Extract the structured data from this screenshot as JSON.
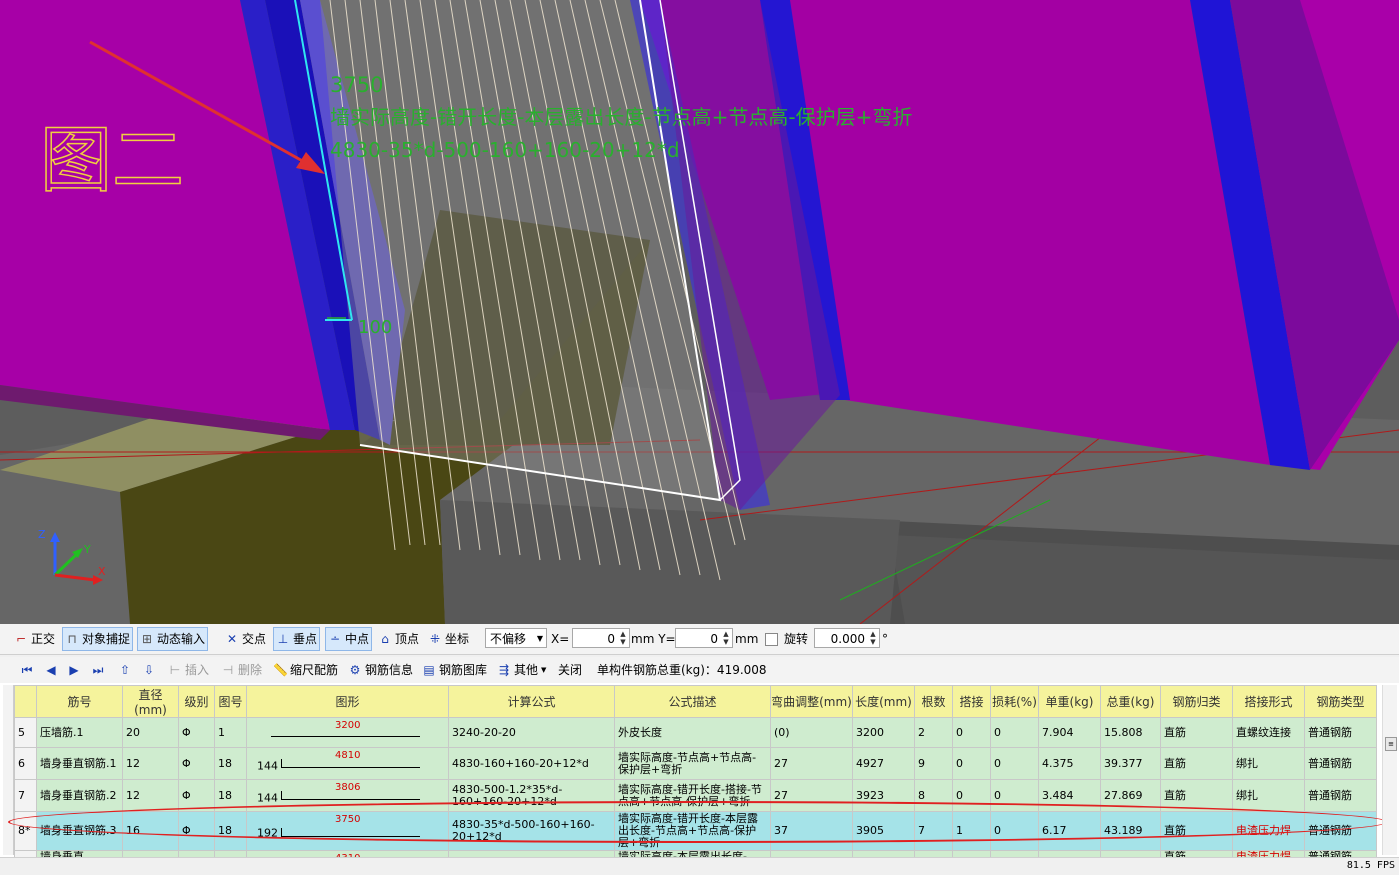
{
  "viewport": {
    "dimension_value": "3750",
    "formula_desc": "墙实际高度-错开长度-本层露出长度-节点高+节点高-保护层+弯折",
    "formula_calc": "4830-35*d-500-160+160-20+12*d",
    "bend_value": "100",
    "annotation_text": "图二",
    "axis_labels": {
      "z": "Z",
      "y": "Y",
      "x": "X"
    },
    "colors": {
      "magenta": "#a800a8",
      "blue": "#1f14d6",
      "floor": "#5d5d5d",
      "label_green": "#29b02e",
      "annotation_red": "#e03030"
    }
  },
  "toolbar1": {
    "ortho": "正交",
    "object_snap": "对象捕捉",
    "dynamic_input": "动态输入",
    "intersection": "交点",
    "perpendicular": "垂点",
    "midpoint": "中点",
    "vertex": "顶点",
    "coordinate": "坐标",
    "offset_select": "不偏移",
    "x_label": "X=",
    "x_value": "0",
    "y_label": "mm Y=",
    "y_value": "0",
    "mm_label": "mm",
    "rotate_label": "旋转",
    "rotate_value": "0.000",
    "degree_symbol": "°"
  },
  "toolbar2": {
    "insert": "插入",
    "delete": "删除",
    "scale_rebar": "缩尺配筋",
    "rebar_info": "钢筋信息",
    "rebar_library": "钢筋图库",
    "other": "其他",
    "close": "关闭",
    "total_weight": "单构件钢筋总重(kg)：419.008"
  },
  "table": {
    "headers": [
      "",
      "筋号",
      "直径(mm)",
      "级别",
      "图号",
      "图形",
      "计算公式",
      "公式描述",
      "弯曲调整(mm)",
      "长度(mm)",
      "根数",
      "搭接",
      "损耗(%)",
      "单重(kg)",
      "总重(kg)",
      "钢筋归类",
      "搭接形式",
      "钢筋类型"
    ],
    "rows": [
      {
        "num": "5",
        "name": "压墙筋.1",
        "dia": "20",
        "grade": "Φ",
        "fig": "1",
        "shape_left": "",
        "shape_value": "3200",
        "formula": "3240-20-20",
        "desc": "外皮长度",
        "bend": "(0)",
        "length": "3200",
        "count": "2",
        "lap": "0",
        "loss": "0",
        "unit_w": "7.904",
        "total_w": "15.808",
        "category": "直筋",
        "lap_type": "直螺纹连接",
        "rebar_type": "普通钢筋"
      },
      {
        "num": "6",
        "name": "墙身垂直钢筋.1",
        "dia": "12",
        "grade": "Φ",
        "fig": "18",
        "shape_left": "144",
        "shape_value": "4810",
        "formula": "4830-160+160-20+12*d",
        "desc": "墙实际高度-节点高+节点高-保护层+弯折",
        "bend": "27",
        "length": "4927",
        "count": "9",
        "lap": "0",
        "loss": "0",
        "unit_w": "4.375",
        "total_w": "39.377",
        "category": "直筋",
        "lap_type": "绑扎",
        "rebar_type": "普通钢筋"
      },
      {
        "num": "7",
        "name": "墙身垂直钢筋.2",
        "dia": "12",
        "grade": "Φ",
        "fig": "18",
        "shape_left": "144",
        "shape_value": "3806",
        "formula": "4830-500-1.2*35*d-160+160-20+12*d",
        "desc": "墙实际高度-错开长度-搭接-节点高+节点高-保护层+弯折",
        "bend": "27",
        "length": "3923",
        "count": "8",
        "lap": "0",
        "loss": "0",
        "unit_w": "3.484",
        "total_w": "27.869",
        "category": "直筋",
        "lap_type": "绑扎",
        "rebar_type": "普通钢筋"
      },
      {
        "num": "8*",
        "name": "墙身垂直钢筋.3",
        "dia": "16",
        "grade": "Φ",
        "fig": "18",
        "shape_left": "192",
        "shape_value": "3750",
        "formula": "4830-35*d-500-160+160-20+12*d",
        "desc": "墙实际高度-错开长度-本层露出长度-节点高+节点高-保护层+弯折",
        "bend": "37",
        "length": "3905",
        "count": "7",
        "lap": "1",
        "loss": "0",
        "unit_w": "6.17",
        "total_w": "43.189",
        "category": "直筋",
        "lap_type": "电渣压力焊",
        "rebar_type": "普通钢筋"
      },
      {
        "num": "",
        "name": "墙身垂直",
        "dia": "",
        "grade": "",
        "fig": "",
        "shape_left": "",
        "shape_value": "4310",
        "formula": "",
        "desc": "墙实际高度-本层露出长度-",
        "bend": "",
        "length": "",
        "count": "",
        "lap": "",
        "loss": "",
        "unit_w": "",
        "total_w": "",
        "category": "直筋",
        "lap_type": "电渣压力焊",
        "rebar_type": "普通钢筋"
      }
    ]
  },
  "status": {
    "fps": "81.5 FPS"
  }
}
